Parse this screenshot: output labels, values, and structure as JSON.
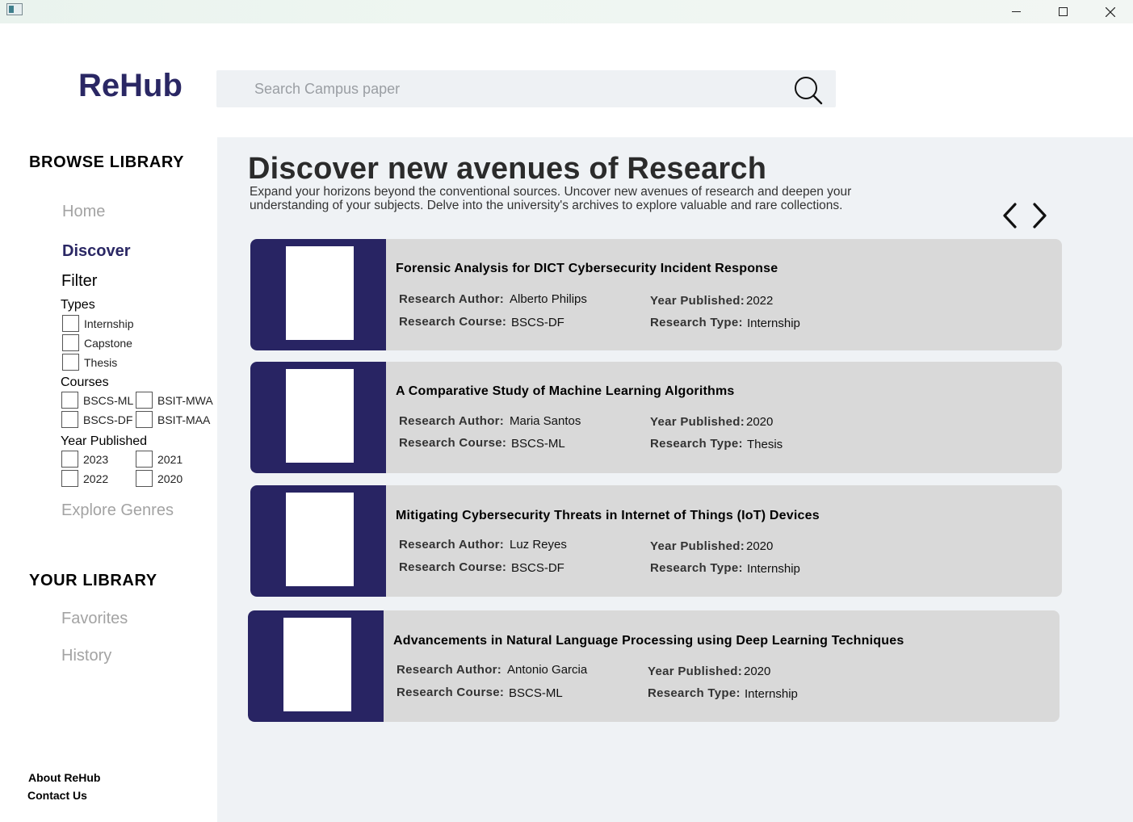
{
  "app": {
    "name": "ReHub"
  },
  "search": {
    "placeholder": "Search Campus paper"
  },
  "sidebar": {
    "browse_heading": "BROWSE  LIBRARY",
    "home": "Home",
    "discover": "Discover",
    "filter": "Filter",
    "types_label": "Types",
    "types": [
      "Internship",
      "Capstone",
      "Thesis"
    ],
    "courses_label": "Courses",
    "courses": [
      "BSCS-ML",
      "BSIT-MWA",
      "BSCS-DF",
      "BSIT-MAA"
    ],
    "year_label": "Year Published",
    "years": [
      "2023",
      "2021",
      "2022",
      "2020"
    ],
    "explore": "Explore Genres",
    "library_heading": "YOUR  LIBRARY",
    "favorites": "Favorites",
    "history": "History",
    "about": "About ReHub",
    "contact": "Contact Us"
  },
  "main": {
    "title": "Discover new avenues of Research",
    "description": "Expand your horizons beyond the conventional sources. Uncover new avenues of research and deepen your understanding of your subjects. Delve into the university's archives to explore valuable and rare collections."
  },
  "labels": {
    "author": "Research Author:",
    "course": "Research Course:",
    "year": "Year Published:",
    "type": "Research Type:"
  },
  "papers": [
    {
      "title": "Forensic Analysis for DICT Cybersecurity Incident Response",
      "author": "Alberto Philips",
      "course": "BSCS-DF",
      "year": "2022",
      "type": "Internship"
    },
    {
      "title": "A Comparative Study of Machine Learning Algorithms",
      "author": "Maria Santos",
      "course": "BSCS-ML",
      "year": "2020",
      "type": "Thesis"
    },
    {
      "title": "Mitigating Cybersecurity Threats in Internet of Things (IoT) Devices",
      "author": "Luz Reyes",
      "course": "BSCS-DF",
      "year": "2020",
      "type": "Internship"
    },
    {
      "title": "Advancements in Natural Language Processing using Deep Learning Techniques",
      "author": "Antonio Garcia",
      "course": "BSCS-ML",
      "year": "2020",
      "type": "Internship"
    }
  ],
  "colors": {
    "brand": "#2a2764",
    "card": "#d9d9d9",
    "main_bg": "#eff2f5"
  }
}
